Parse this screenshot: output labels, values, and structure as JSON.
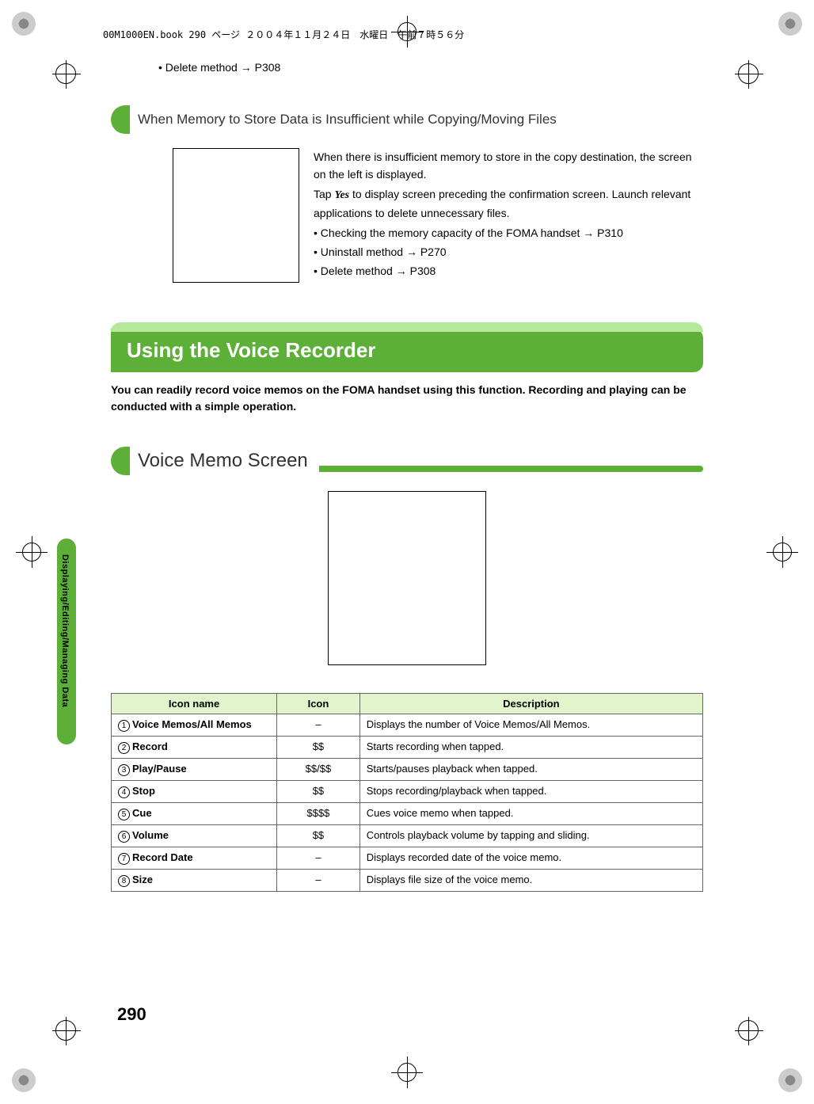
{
  "header": "00M1000EN.book  290 ページ  ２００４年１１月２４日　水曜日　午前７時５６分",
  "top_bullet": "• Delete method → P308",
  "section1": {
    "title": "When Memory to Store Data is Insufficient while Copying/Moving Files",
    "para1": "When there is insufficient memory to store in the copy destination, the screen on the left is displayed.",
    "para2a": "Tap ",
    "para2_yes": "Yes",
    "para2b": " to display screen preceding the confirmation screen. Launch relevant applications to delete unnecessary files.",
    "b1": "• Checking the memory capacity of the FOMA handset → P310",
    "b2": "• Uninstall method → P270",
    "b3": "• Delete method → P308"
  },
  "banner": "Using the Voice Recorder",
  "intro": "You can readily record voice memos on the FOMA handset using this function. Recording and playing can be conducted with a simple operation.",
  "section2_title": "Voice Memo Screen",
  "table": {
    "h1": "Icon name",
    "h2": "Icon",
    "h3": "Description",
    "rows": [
      {
        "num": "1",
        "name": "Voice Memos/All Memos",
        "name2": "Memos",
        "icon": "–",
        "desc": "Displays the number of Voice Memos/All Memos."
      },
      {
        "num": "2",
        "name": "Record",
        "icon": "$$",
        "desc": "Starts recording when tapped."
      },
      {
        "num": "3",
        "name": "Play/Pause",
        "icon": "$$/$$",
        "desc": "Starts/pauses playback when tapped."
      },
      {
        "num": "4",
        "name": "Stop",
        "icon": "$$",
        "desc": "Stops recording/playback when tapped."
      },
      {
        "num": "5",
        "name": "Cue",
        "icon": "$$$$",
        "desc": "Cues voice memo when tapped."
      },
      {
        "num": "6",
        "name": "Volume",
        "icon": "$$",
        "desc": "Controls playback volume by tapping and sliding."
      },
      {
        "num": "7",
        "name": "Record Date",
        "icon": "–",
        "desc": "Displays recorded date of the voice memo."
      },
      {
        "num": "8",
        "name": "Size",
        "icon": "–",
        "desc": "Displays file size of the voice memo."
      }
    ]
  },
  "side_text": "Displaying/Editing/Managing Data",
  "page_num": "290"
}
